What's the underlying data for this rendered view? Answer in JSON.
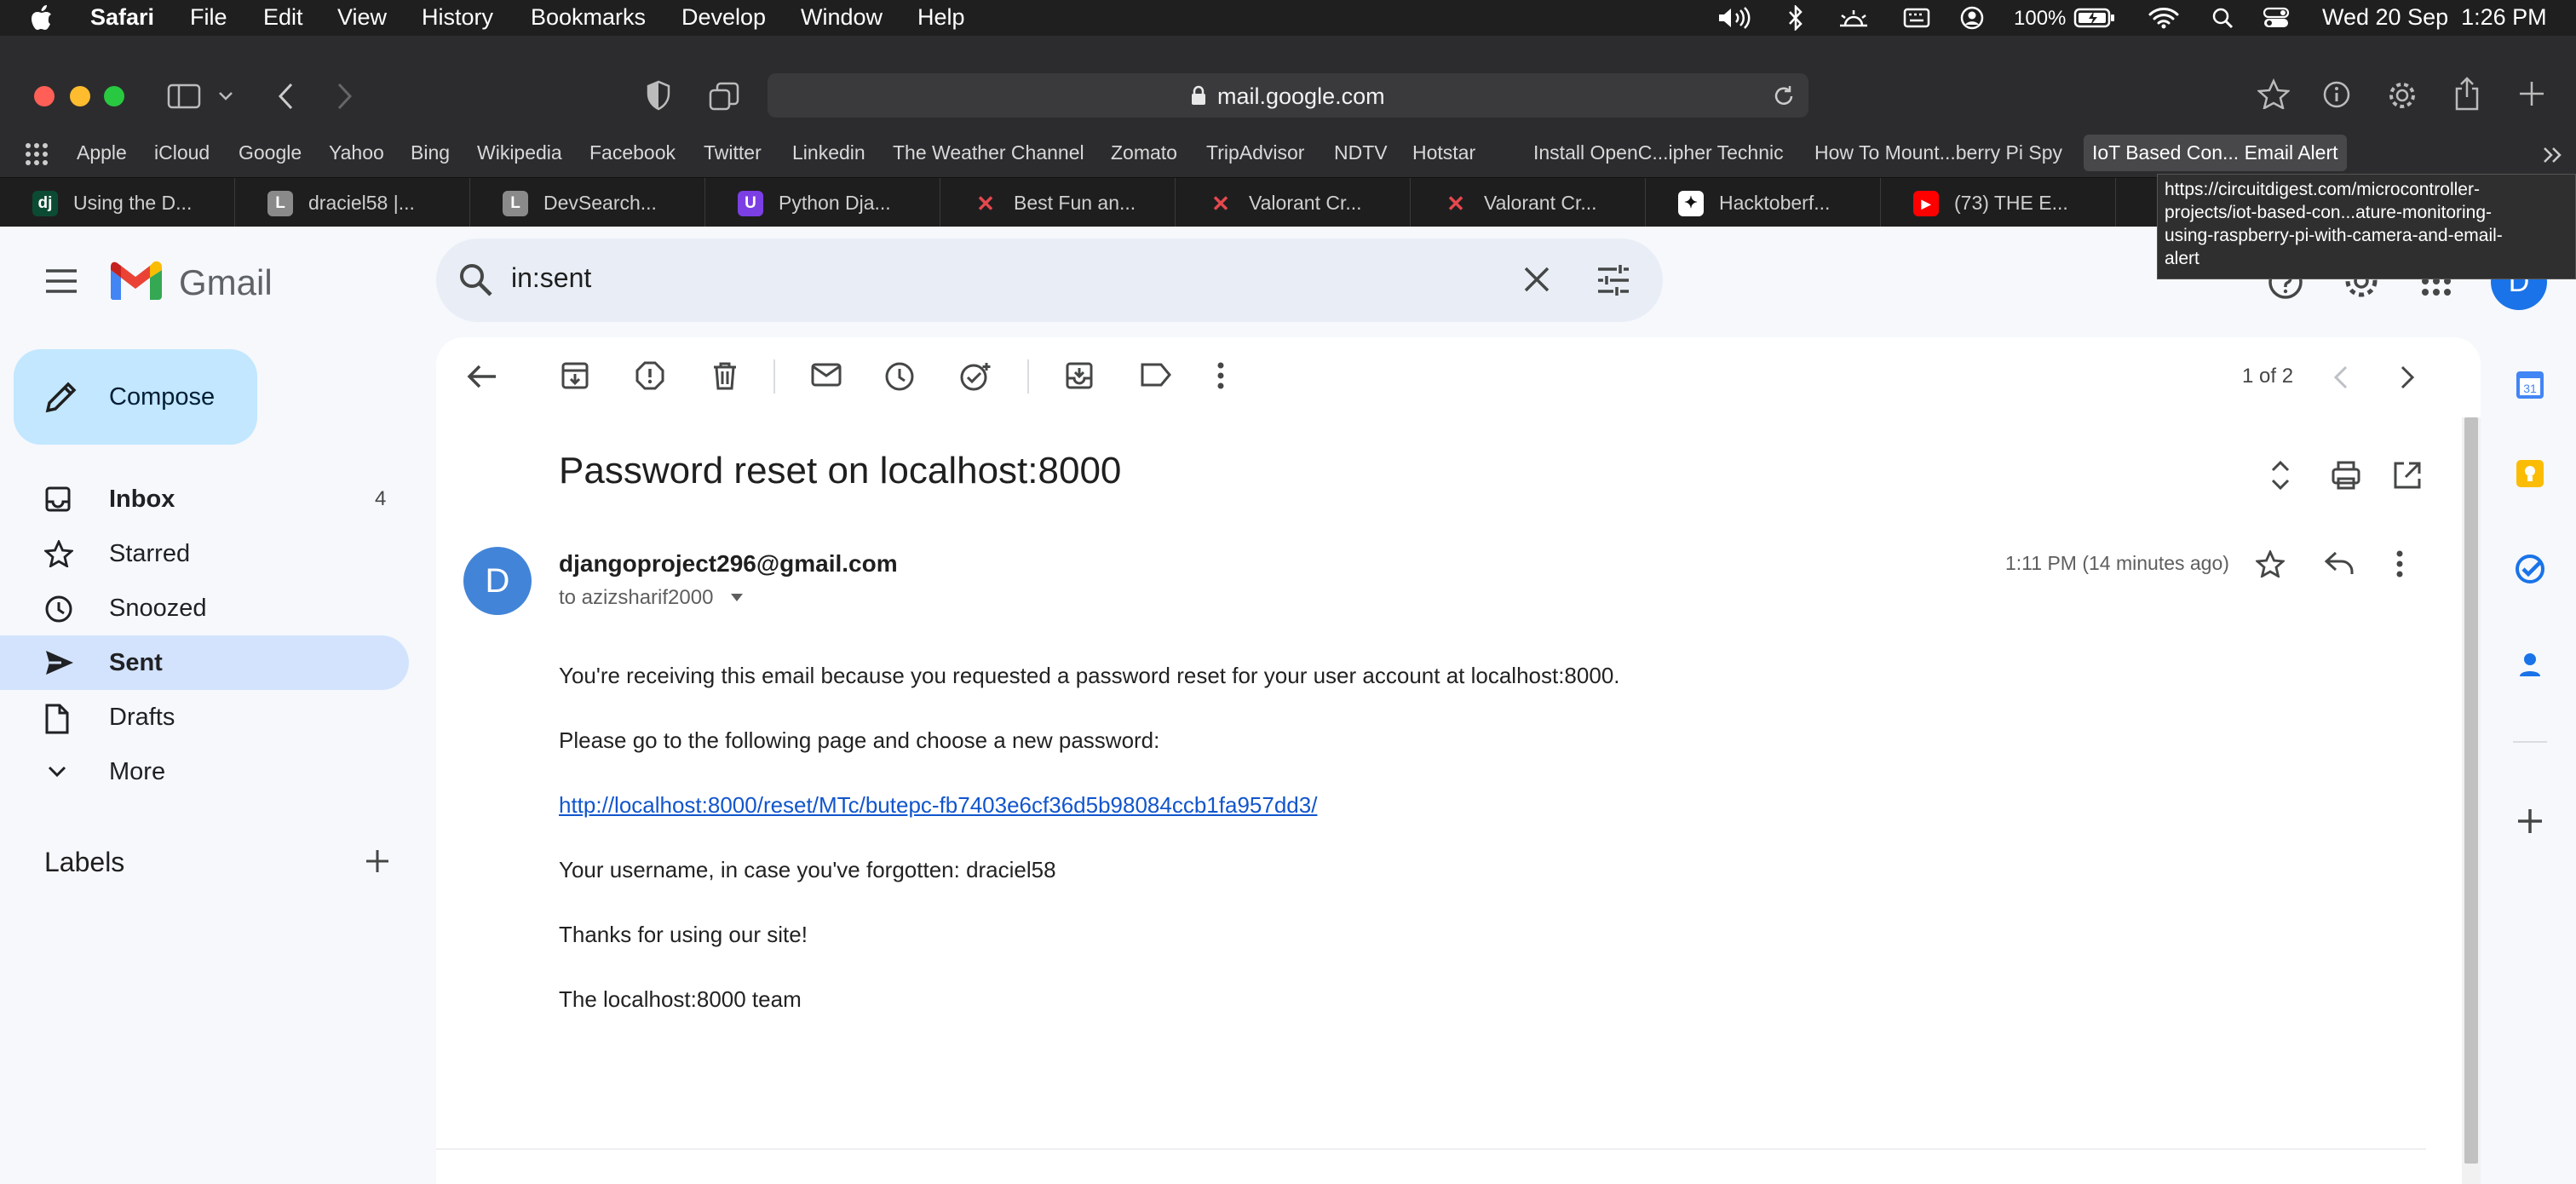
{
  "menubar": {
    "app": "Safari",
    "items": [
      "File",
      "Edit",
      "View",
      "History",
      "Bookmarks",
      "Develop",
      "Window",
      "Help"
    ],
    "battery": "100%",
    "datetime": "Wed 20 Sep  1:26 PM"
  },
  "browser": {
    "url": "mail.google.com",
    "favorites": [
      "Apple",
      "iCloud",
      "Google",
      "Yahoo",
      "Bing",
      "Wikipedia",
      "Facebook",
      "Twitter",
      "Linkedin",
      "The Weather Channel",
      "Zomato",
      "TripAdvisor",
      "NDTV",
      "Hotstar",
      "Install OpenC...ipher Technic",
      "How To Mount...berry Pi Spy",
      "IoT Based Con... Email Alert"
    ],
    "tabs": [
      {
        "label": "Using the D...",
        "icon_text": "dj",
        "color": "#0c4b33"
      },
      {
        "label": "draciel58 |...",
        "icon_text": "L",
        "color": "#8a8a8a"
      },
      {
        "label": "DevSearch...",
        "icon_text": "L",
        "color": "#8a8a8a"
      },
      {
        "label": "Python Dja...",
        "icon_text": "U",
        "color": "#7b3fe4"
      },
      {
        "label": "Best Fun an...",
        "icon_text": "✕",
        "color": "#e5484d"
      },
      {
        "label": "Valorant Cr...",
        "icon_text": "✕",
        "color": "#e5484d"
      },
      {
        "label": "Valorant Cr...",
        "icon_text": "✕",
        "color": "#e5484d"
      },
      {
        "label": "Hacktoberf...",
        "icon_text": "✦",
        "color": "#ffffff"
      },
      {
        "label": "(73) THE E...",
        "icon_text": "▶",
        "color": "#ff0000"
      }
    ],
    "tooltip_lines": [
      "https://circuitdigest.com/microcontroller-",
      "projects/iot-based-con...ature-monitoring-",
      "using-raspberry-pi-with-camera-and-email-",
      "alert"
    ]
  },
  "gmail": {
    "logo_text": "Gmail",
    "search_value": "in:sent",
    "avatar_letter": "D",
    "compose_label": "Compose",
    "nav": [
      {
        "label": "Inbox",
        "count": "4",
        "icon": "inbox-icon"
      },
      {
        "label": "Starred",
        "count": "",
        "icon": "star-icon"
      },
      {
        "label": "Snoozed",
        "count": "",
        "icon": "clock-icon"
      },
      {
        "label": "Sent",
        "count": "",
        "icon": "send-icon"
      },
      {
        "label": "Drafts",
        "count": "",
        "icon": "draft-icon"
      },
      {
        "label": "More",
        "count": "",
        "icon": "chevron-down-icon"
      }
    ],
    "labels_heading": "Labels",
    "pagination": "1 of 2",
    "email": {
      "subject": "Password reset on localhost:8000",
      "sender": "djangoproject296@gmail.com",
      "sender_initial": "D",
      "to": "to azizsharif2000",
      "time": "1:11 PM (14 minutes ago)",
      "body": {
        "p1": "You're receiving this email because you requested a password reset for your user account at localhost:8000.",
        "p2": "Please go to the following page and choose a new password:",
        "link": "http://localhost:8000/reset/MTc/butepc-fb7403e6cf36d5b98084ccb1fa957dd3/",
        "p3": "Your username, in case you've forgotten: draciel58",
        "p4": "Thanks for using our site!",
        "p5": "The localhost:8000 team"
      }
    }
  }
}
